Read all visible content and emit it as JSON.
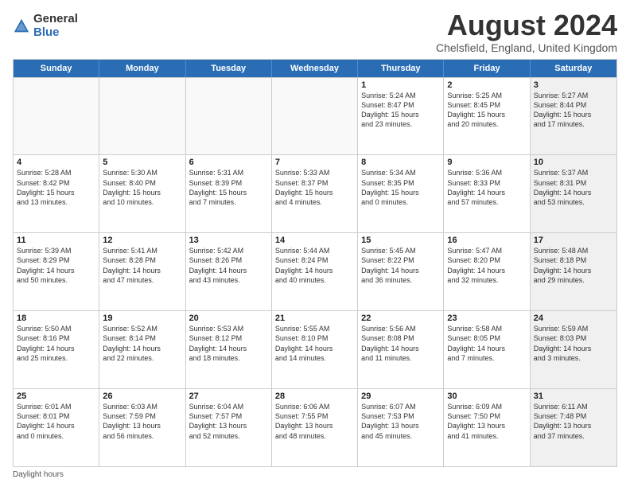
{
  "header": {
    "logo_general": "General",
    "logo_blue": "Blue",
    "month_title": "August 2024",
    "location": "Chelsfield, England, United Kingdom"
  },
  "days_of_week": [
    "Sunday",
    "Monday",
    "Tuesday",
    "Wednesday",
    "Thursday",
    "Friday",
    "Saturday"
  ],
  "footer": "Daylight hours",
  "weeks": [
    [
      {
        "day": "",
        "text": "",
        "empty": true
      },
      {
        "day": "",
        "text": "",
        "empty": true
      },
      {
        "day": "",
        "text": "",
        "empty": true
      },
      {
        "day": "",
        "text": "",
        "empty": true
      },
      {
        "day": "1",
        "text": "Sunrise: 5:24 AM\nSunset: 8:47 PM\nDaylight: 15 hours\nand 23 minutes.",
        "empty": false
      },
      {
        "day": "2",
        "text": "Sunrise: 5:25 AM\nSunset: 8:45 PM\nDaylight: 15 hours\nand 20 minutes.",
        "empty": false
      },
      {
        "day": "3",
        "text": "Sunrise: 5:27 AM\nSunset: 8:44 PM\nDaylight: 15 hours\nand 17 minutes.",
        "empty": false,
        "shaded": true
      }
    ],
    [
      {
        "day": "4",
        "text": "Sunrise: 5:28 AM\nSunset: 8:42 PM\nDaylight: 15 hours\nand 13 minutes.",
        "empty": false
      },
      {
        "day": "5",
        "text": "Sunrise: 5:30 AM\nSunset: 8:40 PM\nDaylight: 15 hours\nand 10 minutes.",
        "empty": false
      },
      {
        "day": "6",
        "text": "Sunrise: 5:31 AM\nSunset: 8:39 PM\nDaylight: 15 hours\nand 7 minutes.",
        "empty": false
      },
      {
        "day": "7",
        "text": "Sunrise: 5:33 AM\nSunset: 8:37 PM\nDaylight: 15 hours\nand 4 minutes.",
        "empty": false
      },
      {
        "day": "8",
        "text": "Sunrise: 5:34 AM\nSunset: 8:35 PM\nDaylight: 15 hours\nand 0 minutes.",
        "empty": false
      },
      {
        "day": "9",
        "text": "Sunrise: 5:36 AM\nSunset: 8:33 PM\nDaylight: 14 hours\nand 57 minutes.",
        "empty": false
      },
      {
        "day": "10",
        "text": "Sunrise: 5:37 AM\nSunset: 8:31 PM\nDaylight: 14 hours\nand 53 minutes.",
        "empty": false,
        "shaded": true
      }
    ],
    [
      {
        "day": "11",
        "text": "Sunrise: 5:39 AM\nSunset: 8:29 PM\nDaylight: 14 hours\nand 50 minutes.",
        "empty": false
      },
      {
        "day": "12",
        "text": "Sunrise: 5:41 AM\nSunset: 8:28 PM\nDaylight: 14 hours\nand 47 minutes.",
        "empty": false
      },
      {
        "day": "13",
        "text": "Sunrise: 5:42 AM\nSunset: 8:26 PM\nDaylight: 14 hours\nand 43 minutes.",
        "empty": false
      },
      {
        "day": "14",
        "text": "Sunrise: 5:44 AM\nSunset: 8:24 PM\nDaylight: 14 hours\nand 40 minutes.",
        "empty": false
      },
      {
        "day": "15",
        "text": "Sunrise: 5:45 AM\nSunset: 8:22 PM\nDaylight: 14 hours\nand 36 minutes.",
        "empty": false
      },
      {
        "day": "16",
        "text": "Sunrise: 5:47 AM\nSunset: 8:20 PM\nDaylight: 14 hours\nand 32 minutes.",
        "empty": false
      },
      {
        "day": "17",
        "text": "Sunrise: 5:48 AM\nSunset: 8:18 PM\nDaylight: 14 hours\nand 29 minutes.",
        "empty": false,
        "shaded": true
      }
    ],
    [
      {
        "day": "18",
        "text": "Sunrise: 5:50 AM\nSunset: 8:16 PM\nDaylight: 14 hours\nand 25 minutes.",
        "empty": false
      },
      {
        "day": "19",
        "text": "Sunrise: 5:52 AM\nSunset: 8:14 PM\nDaylight: 14 hours\nand 22 minutes.",
        "empty": false
      },
      {
        "day": "20",
        "text": "Sunrise: 5:53 AM\nSunset: 8:12 PM\nDaylight: 14 hours\nand 18 minutes.",
        "empty": false
      },
      {
        "day": "21",
        "text": "Sunrise: 5:55 AM\nSunset: 8:10 PM\nDaylight: 14 hours\nand 14 minutes.",
        "empty": false
      },
      {
        "day": "22",
        "text": "Sunrise: 5:56 AM\nSunset: 8:08 PM\nDaylight: 14 hours\nand 11 minutes.",
        "empty": false
      },
      {
        "day": "23",
        "text": "Sunrise: 5:58 AM\nSunset: 8:05 PM\nDaylight: 14 hours\nand 7 minutes.",
        "empty": false
      },
      {
        "day": "24",
        "text": "Sunrise: 5:59 AM\nSunset: 8:03 PM\nDaylight: 14 hours\nand 3 minutes.",
        "empty": false,
        "shaded": true
      }
    ],
    [
      {
        "day": "25",
        "text": "Sunrise: 6:01 AM\nSunset: 8:01 PM\nDaylight: 14 hours\nand 0 minutes.",
        "empty": false
      },
      {
        "day": "26",
        "text": "Sunrise: 6:03 AM\nSunset: 7:59 PM\nDaylight: 13 hours\nand 56 minutes.",
        "empty": false
      },
      {
        "day": "27",
        "text": "Sunrise: 6:04 AM\nSunset: 7:57 PM\nDaylight: 13 hours\nand 52 minutes.",
        "empty": false
      },
      {
        "day": "28",
        "text": "Sunrise: 6:06 AM\nSunset: 7:55 PM\nDaylight: 13 hours\nand 48 minutes.",
        "empty": false
      },
      {
        "day": "29",
        "text": "Sunrise: 6:07 AM\nSunset: 7:53 PM\nDaylight: 13 hours\nand 45 minutes.",
        "empty": false
      },
      {
        "day": "30",
        "text": "Sunrise: 6:09 AM\nSunset: 7:50 PM\nDaylight: 13 hours\nand 41 minutes.",
        "empty": false
      },
      {
        "day": "31",
        "text": "Sunrise: 6:11 AM\nSunset: 7:48 PM\nDaylight: 13 hours\nand 37 minutes.",
        "empty": false,
        "shaded": true
      }
    ]
  ]
}
